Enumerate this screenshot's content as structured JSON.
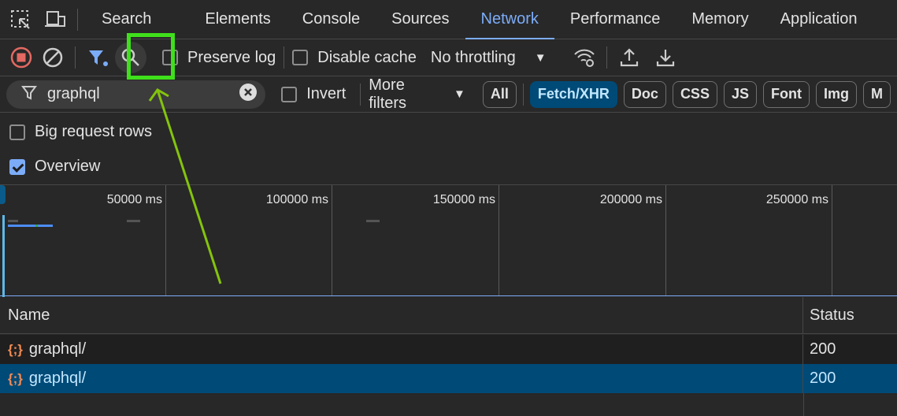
{
  "tabs": {
    "items": [
      "Search",
      "Elements",
      "Console",
      "Sources",
      "Network",
      "Performance",
      "Memory",
      "Application"
    ],
    "active": "Network"
  },
  "toolbar": {
    "preserve_log": "Preserve log",
    "disable_cache": "Disable cache",
    "throttling": "No throttling"
  },
  "filter": {
    "value": "graphql",
    "invert": "Invert",
    "more_filters": "More filters",
    "chips": [
      "All",
      "Fetch/XHR",
      "Doc",
      "CSS",
      "JS",
      "Font",
      "Img",
      "M"
    ],
    "active_chip": "Fetch/XHR"
  },
  "options": {
    "big_rows": "Big request rows",
    "overview": "Overview",
    "overview_checked": true,
    "big_rows_checked": false
  },
  "timeline": {
    "ticks": [
      "50000 ms",
      "100000 ms",
      "150000 ms",
      "200000 ms",
      "250000 ms"
    ]
  },
  "table": {
    "headers": {
      "name": "Name",
      "status": "Status"
    },
    "rows": [
      {
        "name": "graphql/",
        "status": "200",
        "selected": false
      },
      {
        "name": "graphql/",
        "status": "200",
        "selected": true
      }
    ]
  },
  "colors": {
    "accent": "#7cacf8",
    "selected": "#004a77",
    "highlight": "#3fe01b",
    "arrow": "#84c40c"
  }
}
